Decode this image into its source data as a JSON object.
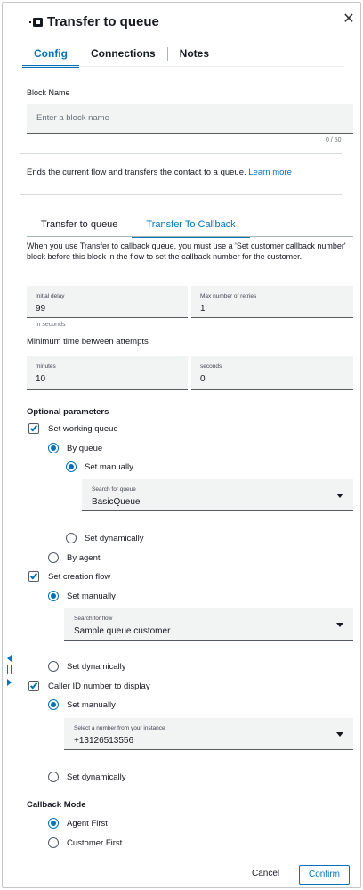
{
  "header": {
    "title": "Transfer to queue"
  },
  "tabs": [
    {
      "label": "Config"
    },
    {
      "label": "Connections"
    },
    {
      "label": "Notes"
    }
  ],
  "block_name": {
    "label": "Block Name",
    "placeholder": "Enter a block name",
    "counter": "0 / 50"
  },
  "description": {
    "text": "Ends the current flow and transfers the contact to a queue.",
    "link": "Learn more"
  },
  "subtabs": [
    {
      "label": "Transfer to queue"
    },
    {
      "label": "Transfer To Callback"
    }
  ],
  "info_text": "When you use Transfer to callback queue, you must use a 'Set customer callback number' block before this block in the flow to set the callback number for the customer.",
  "initial_delay": {
    "label": "Initial delay",
    "value": "99",
    "hint": "in seconds"
  },
  "max_retries": {
    "label": "Max number of retries",
    "value": "1"
  },
  "min_time": {
    "label": "Minimum time between attempts",
    "minutes_label": "minutes",
    "minutes_value": "10",
    "seconds_label": "seconds",
    "seconds_value": "0"
  },
  "optional": {
    "heading": "Optional parameters",
    "working_queue": {
      "label": "Set working queue",
      "by_queue": "By queue",
      "set_manually": "Set manually",
      "select_label": "Search for queue",
      "select_value": "BasicQueue",
      "set_dynamically": "Set dynamically",
      "by_agent": "By agent"
    },
    "creation_flow": {
      "label": "Set creation flow",
      "set_manually": "Set manually",
      "select_label": "Search for flow",
      "select_value": "Sample queue customer",
      "set_dynamically": "Set dynamically"
    },
    "caller_id": {
      "label": "Caller ID number to display",
      "set_manually": "Set manually",
      "select_label": "Select a number from your instance",
      "select_value": "+13126513556",
      "set_dynamically": "Set dynamically"
    }
  },
  "callback_mode": {
    "heading": "Callback Mode",
    "agent_first": "Agent First",
    "customer_first": "Customer First"
  },
  "footer": {
    "cancel": "Cancel",
    "confirm": "Confirm"
  },
  "colors": {
    "accent": "#0073bb",
    "text": "#16191f",
    "field_bg": "#f2f3f3"
  },
  "icons": [
    "transfer-queue-icon",
    "close-icon",
    "chevron-down-icon",
    "collapse-arrow-icon",
    "drag-handle-icon",
    "expand-arrow-icon"
  ]
}
